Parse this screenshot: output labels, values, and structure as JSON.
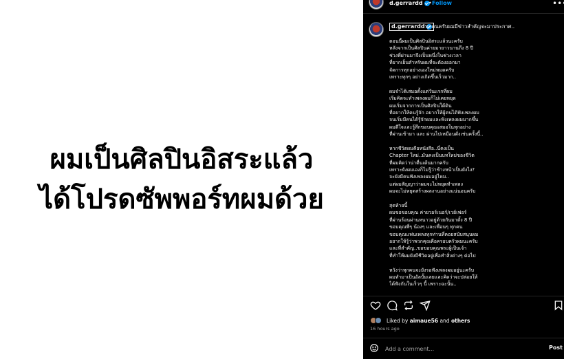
{
  "headline": {
    "line1": "ผมเป็นศิลปินอิสระแล้ว",
    "line2": "ได้โปรดซัพพอร์ทผมด้วย"
  },
  "post": {
    "username": "d.gerrardd",
    "separator": "•",
    "follow_label": "Follow",
    "more_icon": "more-horizontal-icon",
    "caption_username": "d.gerrardd",
    "caption_first_line": "ทุกคนครับผมมีข่าวสำคัญจะมาประกาศ..",
    "caption_lines": [
      "ตอนนี้ผมเป็นศิลปินอิสระแล้วนะครับ",
      "หลังจากเป็นศิลปินค่ายมายาวนานถึง 8 ปี",
      "ช่วงที่ผ่านมาจึงเป็นหนึ่งในช่วงเวลา",
      "ที่ยากเย็นสำหรับผมที่จะต้องออกมา",
      "จัดการทุกอย่างเองใหม่หมดครับ",
      "เพราะทุกๆ อย่างเกิดขึ้นเร็วมาก..",
      "",
      "ผมจำได้เสมอตั้งแต่วันแรกที่ผม",
      "เริ่มคิดจะทำเพลงผมก็ไม่เคยหยุด",
      "ผมเริ่มจากการเป็นศิลปินใต้ดิน",
      "ที่อยากให้คนรู้จัก อยากให้ผู้คนได้ฟังเพลงผม",
      "จนเริ่มมีคนได้รู้จักผมและฟังเพลงผมมากขึ้น",
      "ผมดีใจและรู้สึกขอบคุณเสมอในทุกอย่าง",
      "ที่ผ่านเข้ามา และ ผ่านไปเหมือนดั่งเช่นครั้งนี้..",
      "",
      "หากชีวิตผมคือหนังสือ..นี่คงเป็น",
      "Chapter ใหม่..มันคงเป็นบทใหม่ของชีวิต",
      "ที่ผมคิดว่าน่าตื่นเต้นมากครับ",
      "เพราะยังผมเองก็ไม่รู้ว่าข้างหน้าเป็นยังไง?",
      "จะยังมีคนฟังเพลงผมอยู่ไหม..",
      "แต่ผมสัญญาว่าผมจะไม่หยุดทำเพลง",
      "ผมจะไม่หยุดสร้างผลงานอย่างแน่นอนครับ",
      "",
      "สุดท้ายนี้",
      "ผมขอขอบคุณ ค่ายวอร์เนอร์/เวย์เฟอร์",
      "ที่ผ่านร้อนผ่านหนาวอยู่ด้วยกันมาตั้ง 8 ปี",
      "ขอบคุณพี่ๆ น้องๆ และเพื่อนๆ ทุกคน",
      "ขอบคุณแฟนเพลงทุกท่านที่คอยสนับสนุนผม",
      "อยากให้รู้ว่าพวกคุณคือครอบครัวผมนะครับ",
      "และที่สำคัญ..ขอขอบคุณพระผู้เป็นเจ้า",
      "ที่ทำให้ผมยังมีชีวิตอยู่เพื่อทำสิ่งต่างๆ ต่อไป",
      "",
      "หวังว่าทุกคนจะยังรอฟังเพลงผมอยู่นะครับ",
      "ผมทำมาเป็นอัลบั้มเลยและคิดว่าจะปล่อยให้",
      "ได้ฟังกันในเร็วๆ นี้ เพราะฉะนั้น.."
    ],
    "likes_prefix": "Liked by ",
    "likes_user": "aimaue56",
    "likes_and": " and ",
    "likes_others": "others",
    "time_ago": "16 hours ago",
    "comment_placeholder": "Add a comment...",
    "post_label": "Post",
    "colors": {
      "accent": "#0095f6",
      "background": "#000000",
      "text": "#f5f5f5",
      "muted": "#a8a8a8"
    }
  }
}
